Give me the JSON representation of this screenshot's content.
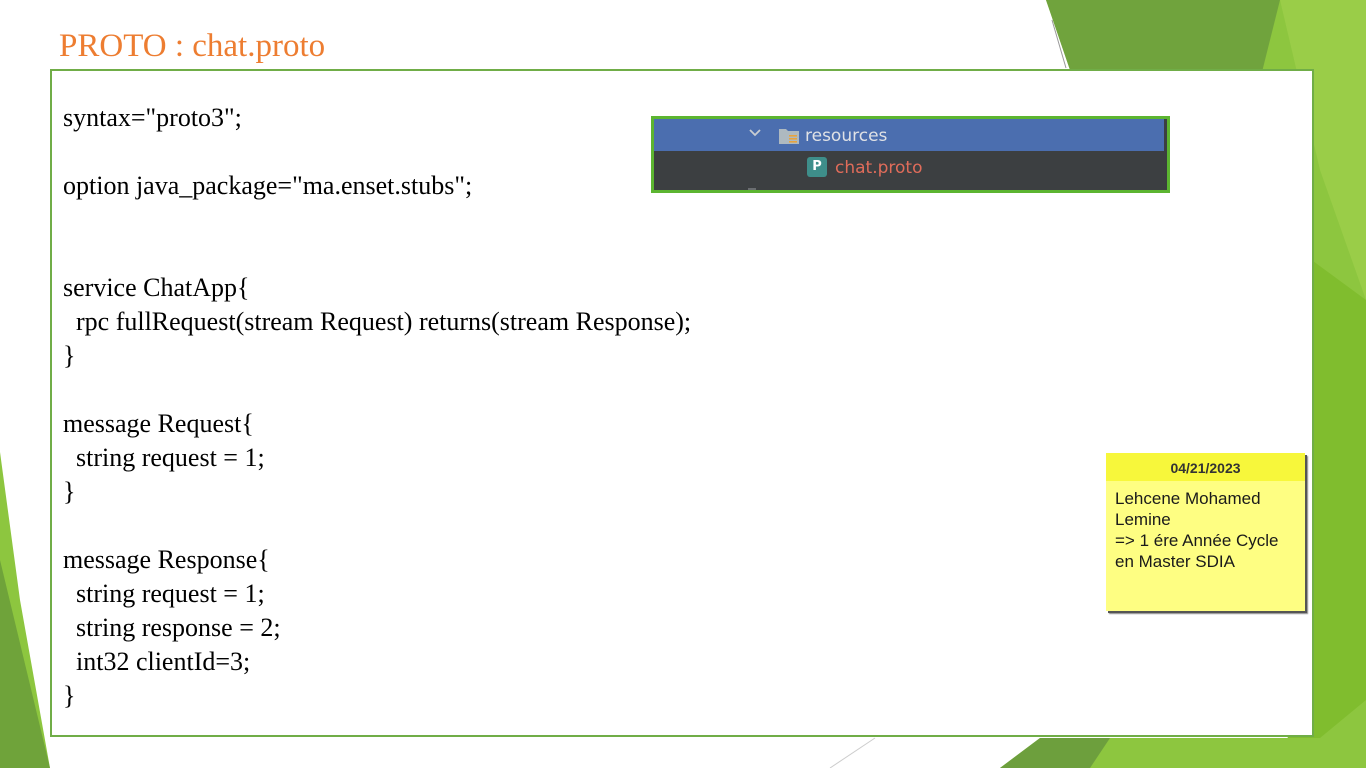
{
  "slide": {
    "title": "PROTO : chat.proto"
  },
  "code": {
    "lines": [
      "syntax=\"proto3\";",
      "option java_package=\"ma.enset.stubs\";",
      "service ChatApp{",
      "  rpc fullRequest(stream Request) returns(stream Response);",
      "}",
      "message Request{",
      "  string request = 1;",
      "}",
      "message Response{",
      "  string request = 1;",
      "  string response = 2;",
      "  int32 clientId=3;",
      "}"
    ]
  },
  "ide_tree": {
    "folder_label": "resources",
    "folder_icon": "folder-icon",
    "file_icon_letter": "P",
    "file_label": "chat.proto",
    "selected_row_color": "#4b6eaf",
    "file_label_color": "#e06c5a"
  },
  "sticky_note": {
    "date": "04/21/2023",
    "body": "Lehcene Mohamed\nLemine\n=> 1 ére Année Cycle\nen Master SDIA"
  },
  "colors": {
    "title": "#ed7d31",
    "accent_green": "#70ad47"
  }
}
